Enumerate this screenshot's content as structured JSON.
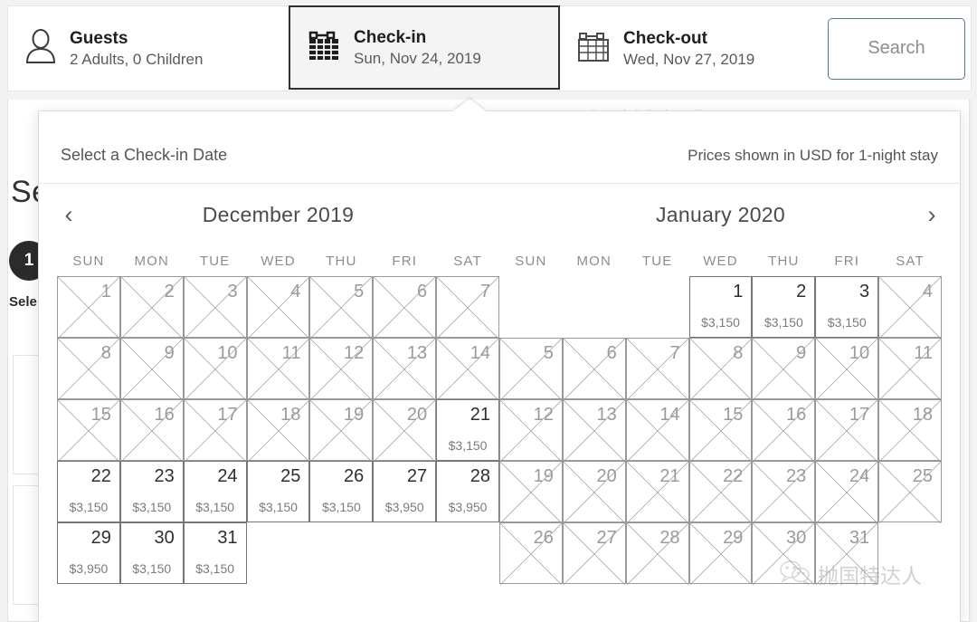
{
  "searchbar": {
    "guests": {
      "icon": "person-icon",
      "label": "Guests",
      "value": "2 Adults, 0 Children"
    },
    "checkin": {
      "icon": "calendar-filled-icon",
      "label": "Check-in",
      "value": "Sun, Nov 24, 2019"
    },
    "checkout": {
      "icon": "calendar-outline-icon",
      "label": "Check-out",
      "value": "Wed, Nov 27, 2019"
    },
    "search_label": "Search"
  },
  "background": {
    "heading": "Se",
    "badge": "1",
    "sub": "Sele",
    "right_text": "Special Orders Request"
  },
  "popup": {
    "title": "Select a Check-in Date",
    "note": "Prices shown in USD for 1-night stay",
    "prev_arrow": "‹",
    "next_arrow": "›",
    "dow": [
      "SUN",
      "MON",
      "TUE",
      "WED",
      "THU",
      "FRI",
      "SAT"
    ],
    "months": [
      {
        "name": "December 2019",
        "lead_blanks": 0,
        "days": [
          {
            "n": "1",
            "price": "",
            "available": false
          },
          {
            "n": "2",
            "price": "",
            "available": false
          },
          {
            "n": "3",
            "price": "",
            "available": false
          },
          {
            "n": "4",
            "price": "",
            "available": false
          },
          {
            "n": "5",
            "price": "",
            "available": false
          },
          {
            "n": "6",
            "price": "",
            "available": false
          },
          {
            "n": "7",
            "price": "",
            "available": false
          },
          {
            "n": "8",
            "price": "",
            "available": false
          },
          {
            "n": "9",
            "price": "",
            "available": false
          },
          {
            "n": "10",
            "price": "",
            "available": false
          },
          {
            "n": "11",
            "price": "",
            "available": false
          },
          {
            "n": "12",
            "price": "",
            "available": false
          },
          {
            "n": "13",
            "price": "",
            "available": false
          },
          {
            "n": "14",
            "price": "",
            "available": false
          },
          {
            "n": "15",
            "price": "",
            "available": false
          },
          {
            "n": "16",
            "price": "",
            "available": false
          },
          {
            "n": "17",
            "price": "",
            "available": false
          },
          {
            "n": "18",
            "price": "",
            "available": false
          },
          {
            "n": "19",
            "price": "",
            "available": false
          },
          {
            "n": "20",
            "price": "",
            "available": false
          },
          {
            "n": "21",
            "price": "$3,150",
            "available": true
          },
          {
            "n": "22",
            "price": "$3,150",
            "available": true
          },
          {
            "n": "23",
            "price": "$3,150",
            "available": true
          },
          {
            "n": "24",
            "price": "$3,150",
            "available": true
          },
          {
            "n": "25",
            "price": "$3,150",
            "available": true
          },
          {
            "n": "26",
            "price": "$3,150",
            "available": true
          },
          {
            "n": "27",
            "price": "$3,950",
            "available": true
          },
          {
            "n": "28",
            "price": "$3,950",
            "available": true
          },
          {
            "n": "29",
            "price": "$3,950",
            "available": true
          },
          {
            "n": "30",
            "price": "$3,150",
            "available": true
          },
          {
            "n": "31",
            "price": "$3,150",
            "available": true
          }
        ]
      },
      {
        "name": "January 2020",
        "lead_blanks": 3,
        "days": [
          {
            "n": "1",
            "price": "$3,150",
            "available": true
          },
          {
            "n": "2",
            "price": "$3,150",
            "available": true
          },
          {
            "n": "3",
            "price": "$3,150",
            "available": true
          },
          {
            "n": "4",
            "price": "",
            "available": false
          },
          {
            "n": "5",
            "price": "",
            "available": false
          },
          {
            "n": "6",
            "price": "",
            "available": false
          },
          {
            "n": "7",
            "price": "",
            "available": false
          },
          {
            "n": "8",
            "price": "",
            "available": false
          },
          {
            "n": "9",
            "price": "",
            "available": false
          },
          {
            "n": "10",
            "price": "",
            "available": false
          },
          {
            "n": "11",
            "price": "",
            "available": false
          },
          {
            "n": "12",
            "price": "",
            "available": false
          },
          {
            "n": "13",
            "price": "",
            "available": false
          },
          {
            "n": "14",
            "price": "",
            "available": false
          },
          {
            "n": "15",
            "price": "",
            "available": false
          },
          {
            "n": "16",
            "price": "",
            "available": false
          },
          {
            "n": "17",
            "price": "",
            "available": false
          },
          {
            "n": "18",
            "price": "",
            "available": false
          },
          {
            "n": "19",
            "price": "",
            "available": false
          },
          {
            "n": "20",
            "price": "",
            "available": false
          },
          {
            "n": "21",
            "price": "",
            "available": false
          },
          {
            "n": "22",
            "price": "",
            "available": false
          },
          {
            "n": "23",
            "price": "",
            "available": false
          },
          {
            "n": "24",
            "price": "",
            "available": false
          },
          {
            "n": "25",
            "price": "",
            "available": false
          },
          {
            "n": "26",
            "price": "",
            "available": false
          },
          {
            "n": "27",
            "price": "",
            "available": false
          },
          {
            "n": "28",
            "price": "",
            "available": false
          },
          {
            "n": "29",
            "price": "",
            "available": false
          },
          {
            "n": "30",
            "price": "",
            "available": false
          },
          {
            "n": "31",
            "price": "",
            "available": false
          }
        ]
      }
    ]
  },
  "watermark": {
    "icon": "wechat-icon",
    "text": "抛国特达人"
  },
  "colors": {
    "accent": "#4e7c8a",
    "text_dark": "#1f1f1f",
    "text_muted": "#7b7b7b",
    "cell_border_available": "#767676",
    "cell_border_unavailable": "#9a9a9a",
    "badge_bg": "#2b2b2b",
    "selected_field_border": "#303030"
  }
}
